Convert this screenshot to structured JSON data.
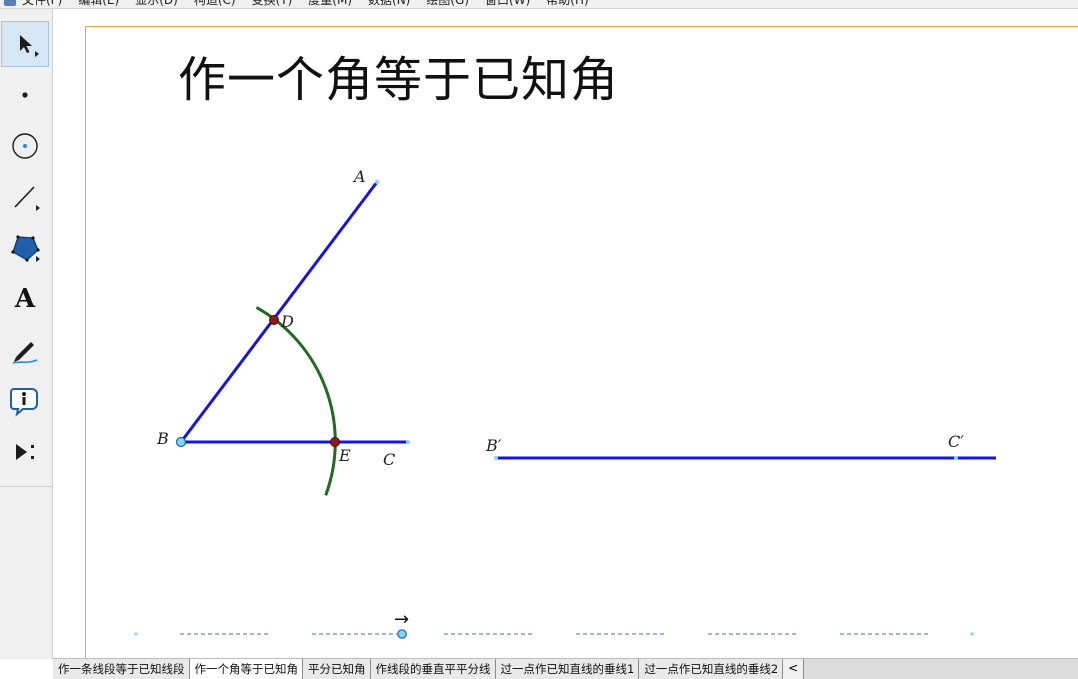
{
  "menu": [
    "文件(F)",
    "编辑(E)",
    "显示(D)",
    "构造(C)",
    "变换(T)",
    "度量(M)",
    "数据(N)",
    "绘图(G)",
    "窗口(W)",
    "帮助(H)"
  ],
  "toolbox": [
    {
      "name": "arrow-tool-icon",
      "active": true
    },
    {
      "name": "point-tool-icon"
    },
    {
      "name": "compass-tool-icon"
    },
    {
      "name": "line-tool-icon"
    },
    {
      "name": "polygon-tool-icon"
    },
    {
      "name": "text-tool-icon",
      "glyph": "A"
    },
    {
      "name": "marker-tool-icon"
    },
    {
      "name": "information-tool-icon"
    },
    {
      "name": "custom-tool-icon"
    }
  ],
  "page": {
    "title": "作一个角等于已知角",
    "points": {
      "A": "A",
      "B": "B",
      "C": "C",
      "D": "D",
      "E": "E",
      "B2": "B′",
      "C2": "C′"
    },
    "nav_arrow": "→"
  },
  "colors": {
    "segment": "#1414e6",
    "arc": "#1f6b1f",
    "intersection": "#8b1a1a",
    "free_point": "#7fd8f0",
    "frame": "#f4a13a"
  },
  "tabs": [
    {
      "label": "作一条线段等于已知线段",
      "active": false
    },
    {
      "label": "作一个角等于已知角",
      "active": true
    },
    {
      "label": "平分已知角",
      "active": false
    },
    {
      "label": "作线段的垂直平平分线",
      "active": false
    },
    {
      "label": "过一点作已知直线的垂线1",
      "active": false
    },
    {
      "label": "过一点作已知直线的垂线2",
      "active": false
    }
  ],
  "tab_scroll_left": "<"
}
